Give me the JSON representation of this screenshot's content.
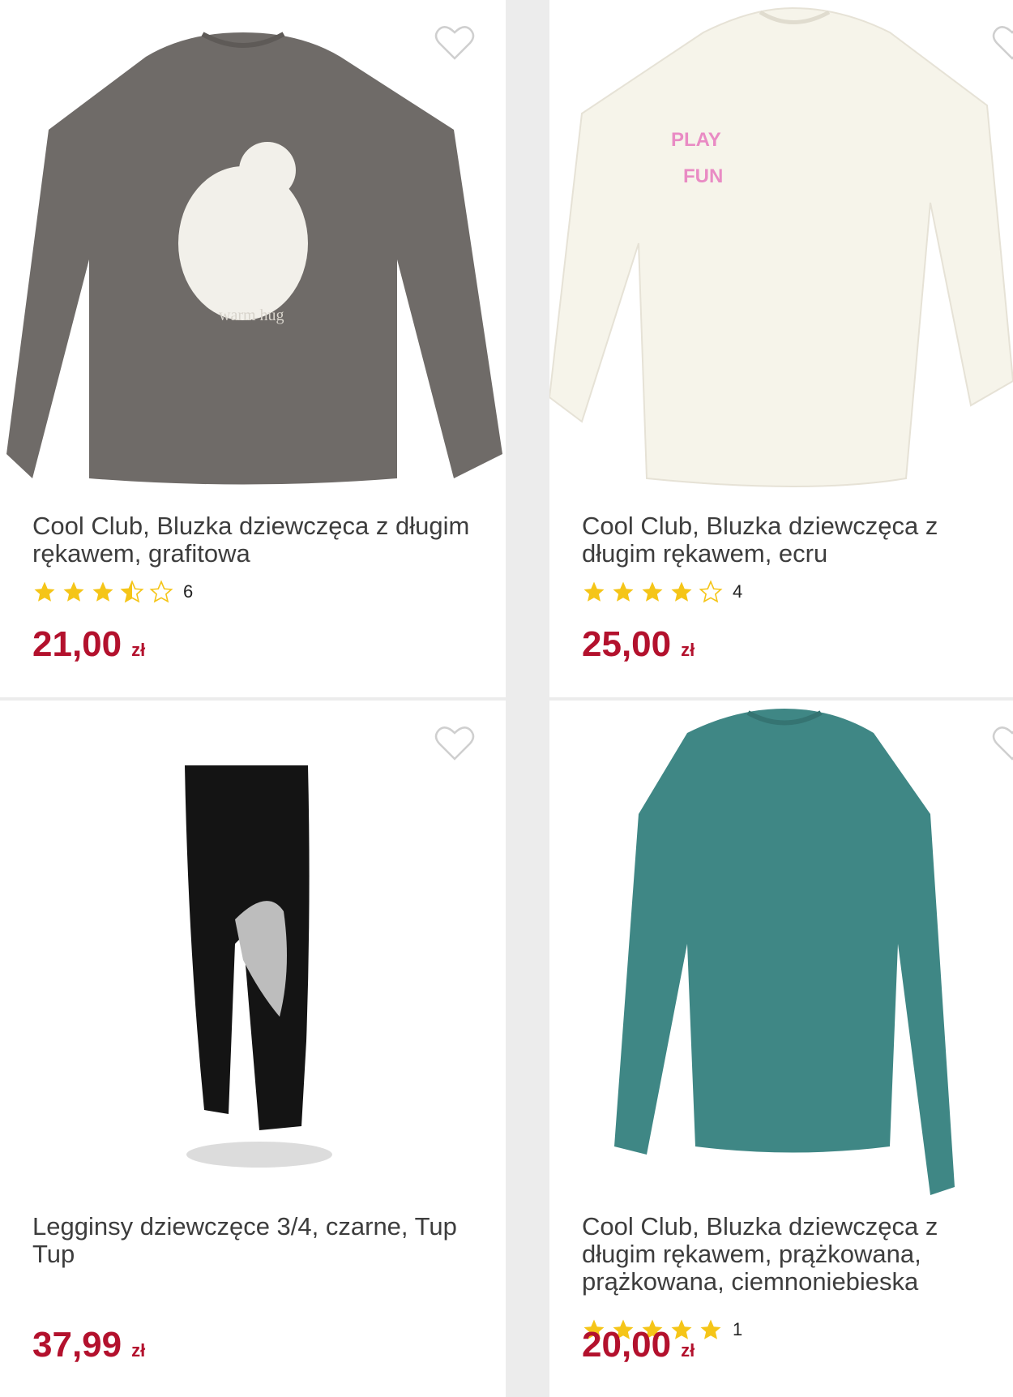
{
  "colors": {
    "price": "#b3112d",
    "star": "#f5c518",
    "background": "#ececec"
  },
  "products": [
    {
      "title": "Cool Club, Bluzka dziewczęca z długim rękawem, grafitowa",
      "rating": 3.5,
      "rating_count": "6",
      "price": "21,00",
      "currency": "zł",
      "favorite_icon": "heart-outline-icon"
    },
    {
      "title": "Cool Club, Bluzka dziewczęca z długim rękawem, ecru",
      "rating": 4,
      "rating_count": "4",
      "price": "25,00",
      "currency": "zł",
      "favorite_icon": "heart-outline-icon"
    },
    {
      "title": "Legginsy dziewczęce 3/4, czarne, Tup Tup",
      "price": "37,99",
      "currency": "zł",
      "favorite_icon": "heart-outline-icon"
    },
    {
      "title": "Cool Club, Bluzka dziewczęca z długim rękawem, prążkowana, prążkowana, ciemnoniebieska",
      "rating": 5,
      "rating_count": "1",
      "price": "20,00",
      "currency": "zł",
      "favorite_icon": "heart-outline-icon"
    }
  ]
}
